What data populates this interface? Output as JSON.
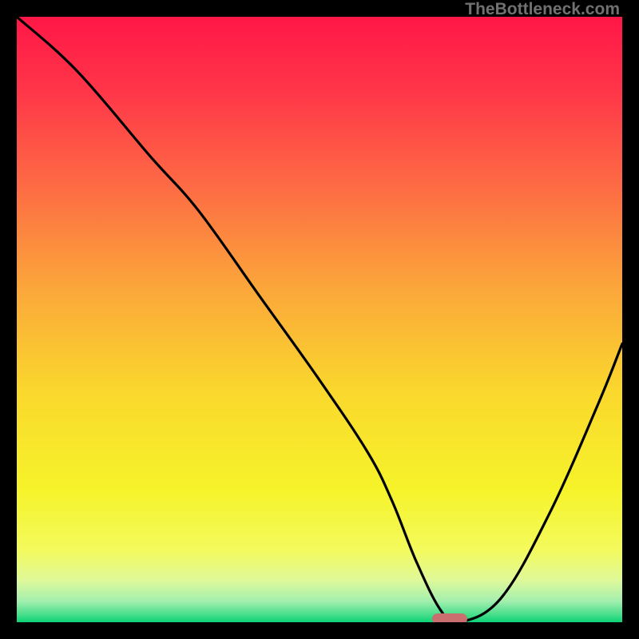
{
  "watermark": "TheBottleneck.com",
  "chart_data": {
    "type": "line",
    "title": "",
    "xlabel": "",
    "ylabel": "",
    "xlim": [
      0,
      100
    ],
    "ylim": [
      0,
      100
    ],
    "grid": false,
    "series": [
      {
        "name": "bottleneck-curve",
        "x": [
          0,
          10,
          22,
          30,
          40,
          50,
          58,
          62,
          66,
          70,
          73,
          80,
          88,
          96,
          100
        ],
        "y": [
          100,
          91,
          77,
          68,
          54,
          40,
          28,
          20,
          10,
          2,
          0,
          4,
          18,
          36,
          46
        ],
        "note": "y is relative height of the black curve; 0 = bottom (green), 100 = top (red). Approximated from pixels."
      }
    ],
    "marker": {
      "name": "optimal-region",
      "x": 71.5,
      "y": 0,
      "color": "#cb6e6f"
    },
    "gradient_stops": [
      {
        "offset": 0.0,
        "color": "#ff1747"
      },
      {
        "offset": 0.12,
        "color": "#ff3549"
      },
      {
        "offset": 0.28,
        "color": "#fd6b44"
      },
      {
        "offset": 0.45,
        "color": "#fba73a"
      },
      {
        "offset": 0.62,
        "color": "#fad82d"
      },
      {
        "offset": 0.78,
        "color": "#f6f32a"
      },
      {
        "offset": 0.88,
        "color": "#f3fa5c"
      },
      {
        "offset": 0.93,
        "color": "#e0f999"
      },
      {
        "offset": 0.965,
        "color": "#a3efae"
      },
      {
        "offset": 0.985,
        "color": "#51e08e"
      },
      {
        "offset": 1.0,
        "color": "#0cd377"
      }
    ]
  }
}
